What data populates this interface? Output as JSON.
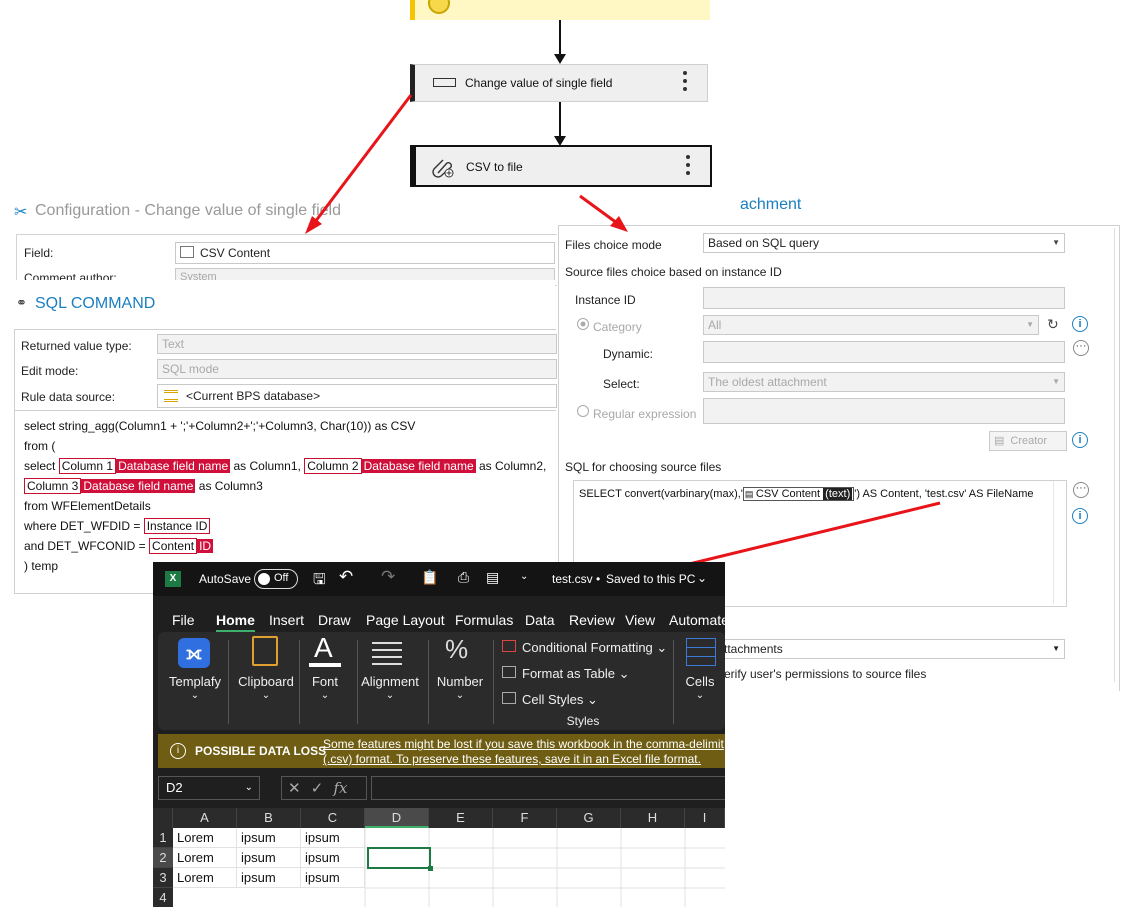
{
  "workflow": {
    "node1_label": "Change value of single field",
    "node2_label": "CSV to file"
  },
  "config_panel": {
    "title": "Configuration - Change value of single field",
    "field_label": "Field:",
    "field_value": "CSV Content",
    "comment_label": "Comment author:",
    "comment_value": "System"
  },
  "sql_panel": {
    "title": "SQL COMMAND",
    "returned_type_label": "Returned value type:",
    "returned_type_value": "Text",
    "edit_mode_label": "Edit mode:",
    "edit_mode_value": "SQL mode",
    "data_source_label": "Rule data source:",
    "data_source_value": "<Current BPS database>",
    "code": {
      "line1": "select string_agg(Column1 + ';'+Column2+';'+Column3, Char(10)) as CSV",
      "line2": "from (",
      "l3_a": "select",
      "l3_col1": "Column 1",
      "l3_db1": "Database field name",
      "l3_b": "as Column1,",
      "l3_col2": "Column 2",
      "l3_db2": "Database field name",
      "l3_c": "as Column2,",
      "l4_col3": "Column 3",
      "l4_db3": "Database field name",
      "l4_a": "as Column3",
      "line5": "from WFElementDetails",
      "l6_a": "where DET_WFDID =",
      "l6_tok": "Instance ID",
      "l7_a": "and DET_WFCONID =",
      "l7_tok1": "Content",
      "l7_tok2": "ID",
      "line8": ") temp"
    }
  },
  "attach_panel": {
    "title": "achment",
    "files_mode_label": "Files choice mode",
    "files_mode_value": "Based on SQL query",
    "source_heading": "Source files choice based on instance ID",
    "instance_id_label": "Instance ID",
    "category_label": "Category",
    "category_value": "All",
    "dynamic_label": "Dynamic:",
    "select_label": "Select:",
    "select_value": "The oldest attachment",
    "regex_label": "Regular expression",
    "creator_label": "Creator",
    "sql_heading": "SQL for choosing source files",
    "sql_a": "SELECT convert(varbinary(max),'",
    "sql_tok": "CSV Content",
    "sql_tok2": "(text)",
    "sql_b": "') AS Content, 'test.csv' AS FileName",
    "bottom_dropdown": "y attachments",
    "verify_text": "erify user's permissions to source files"
  },
  "excel": {
    "autosave": "AutoSave",
    "toggle": "Off",
    "filename": "test.csv",
    "saved": "Saved to this PC",
    "menu": [
      "File",
      "Home",
      "Insert",
      "Draw",
      "Page Layout",
      "Formulas",
      "Data",
      "Review",
      "View",
      "Automate"
    ],
    "ribbon": {
      "templafy": "Templafy",
      "clipboard": "Clipboard",
      "font": "Font",
      "alignment": "Alignment",
      "number": "Number",
      "cond_fmt": "Conditional Formatting",
      "fmt_table": "Format as Table",
      "cell_styles": "Cell Styles",
      "styles": "Styles",
      "cells": "Cells"
    },
    "warning_title": "POSSIBLE DATA LOSS",
    "warning_line1": "Some features might be lost if you save this workbook in the comma-delimit",
    "warning_line2": "(.csv) format. To preserve these features, save it in an Excel file format.",
    "name_box": "D2",
    "fx": "fx",
    "columns": [
      "A",
      "B",
      "C",
      "D",
      "E",
      "F",
      "G",
      "H",
      "I"
    ],
    "rows": [
      {
        "num": "1",
        "cells": [
          "Lorem",
          "ipsum",
          "ipsum"
        ]
      },
      {
        "num": "2",
        "cells": [
          "Lorem",
          "ipsum",
          "ipsum"
        ]
      },
      {
        "num": "3",
        "cells": [
          "Lorem",
          "ipsum",
          "ipsum"
        ]
      },
      {
        "num": "4",
        "cells": [
          "",
          "",
          ""
        ]
      }
    ]
  }
}
